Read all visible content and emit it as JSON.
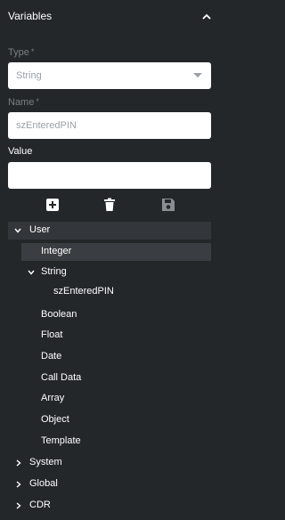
{
  "header": {
    "title": "Variables",
    "collapse_icon": "chevron-up-icon"
  },
  "type_field": {
    "label": "Type",
    "required_mark": "*",
    "value": "String"
  },
  "name_field": {
    "label": "Name",
    "required_mark": "*",
    "value": "szEnteredPIN"
  },
  "value_field": {
    "label": "Value",
    "value": ""
  },
  "toolbar": {
    "add_icon": "add-icon",
    "delete_icon": "trash-icon",
    "save_icon": "save-icon"
  },
  "tree": {
    "user": "User",
    "integer": "Integer",
    "string": "String",
    "szEnteredPIN": "szEnteredPIN",
    "boolean": "Boolean",
    "float": "Float",
    "date": "Date",
    "call_data": "Call Data",
    "array": "Array",
    "object": "Object",
    "template": "Template",
    "system": "System",
    "global": "Global",
    "cdr": "CDR"
  }
}
